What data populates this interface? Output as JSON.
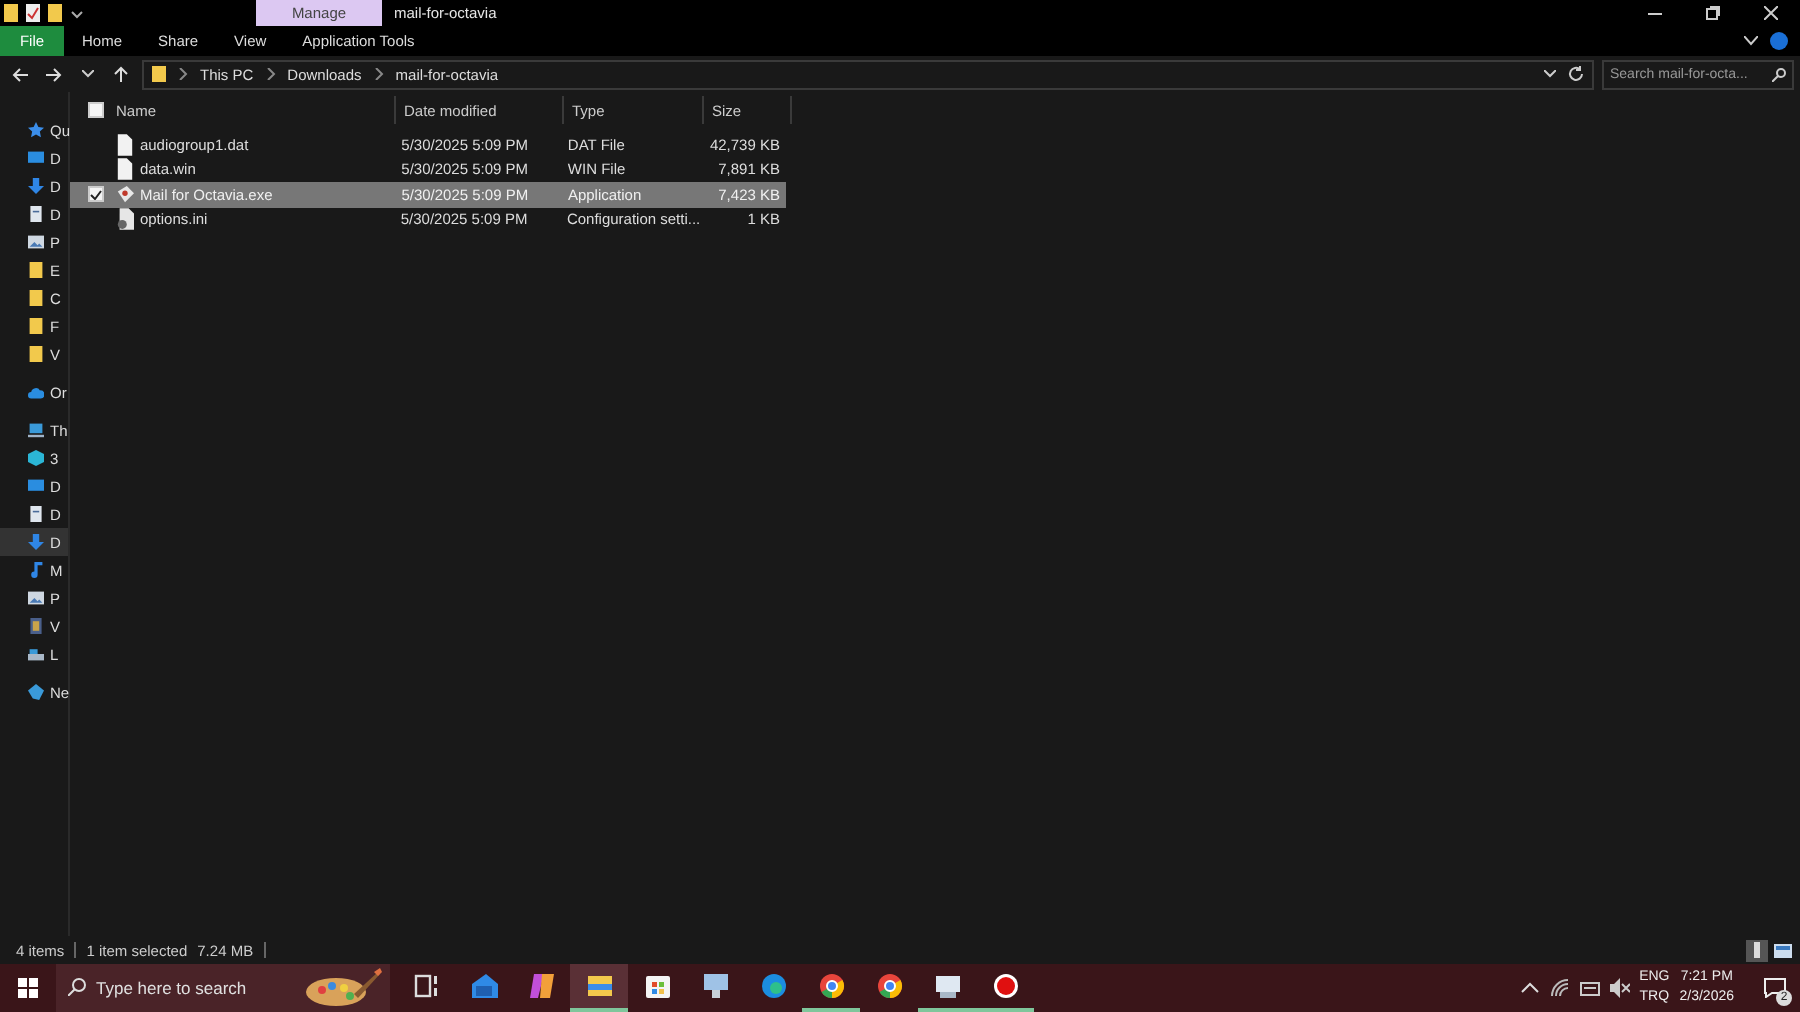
{
  "title_bar": {
    "context_tab": "Manage",
    "title": "mail-for-octavia"
  },
  "ribbon": {
    "tabs": [
      {
        "label": "File",
        "kind": "file"
      },
      {
        "label": "Home",
        "kind": "tab"
      },
      {
        "label": "Share",
        "kind": "tab"
      },
      {
        "label": "View",
        "kind": "tab"
      },
      {
        "label": "Application Tools",
        "kind": "tab"
      }
    ]
  },
  "address": {
    "breadcrumbs": [
      "This PC",
      "Downloads",
      "mail-for-octavia"
    ],
    "search": {
      "placeholder": "Search mail-for-octa..."
    }
  },
  "sidebar": {
    "items": [
      {
        "label": "Qu",
        "kind": "star",
        "selected": false
      },
      {
        "label": "D",
        "kind": "desktop",
        "selected": false
      },
      {
        "label": "D",
        "kind": "download",
        "selected": false
      },
      {
        "label": "D",
        "kind": "document",
        "selected": false
      },
      {
        "label": "P",
        "kind": "pictures",
        "selected": false
      },
      {
        "label": "E",
        "kind": "folder",
        "selected": false
      },
      {
        "label": "C",
        "kind": "folder",
        "selected": false
      },
      {
        "label": "F",
        "kind": "folder",
        "selected": false
      },
      {
        "label": "V",
        "kind": "folder",
        "selected": false
      },
      {
        "label": "Or",
        "kind": "cloud",
        "selected": false
      },
      {
        "label": "Th",
        "kind": "pc",
        "selected": false
      },
      {
        "label": "3",
        "kind": "cube",
        "selected": false
      },
      {
        "label": "D",
        "kind": "desktop",
        "selected": false
      },
      {
        "label": "D",
        "kind": "document",
        "selected": false
      },
      {
        "label": "D",
        "kind": "download",
        "selected": true
      },
      {
        "label": "M",
        "kind": "music",
        "selected": false
      },
      {
        "label": "P",
        "kind": "pictures",
        "selected": false
      },
      {
        "label": "V",
        "kind": "video",
        "selected": false
      },
      {
        "label": "L",
        "kind": "drive",
        "selected": false
      },
      {
        "label": "Ne",
        "kind": "network",
        "selected": false
      }
    ]
  },
  "table": {
    "select_all": {
      "checked": false
    },
    "columns": [
      "Name",
      "Date modified",
      "Type",
      "Size"
    ],
    "rows": [
      {
        "name": "audiogroup1.dat",
        "date_modified": "5/30/2025 5:09 PM",
        "type": "DAT File",
        "size": "42,739 KB",
        "kind": "file",
        "selected": false
      },
      {
        "name": "data.win",
        "date_modified": "5/30/2025 5:09 PM",
        "type": "WIN File",
        "size": "7,891 KB",
        "kind": "file",
        "selected": false
      },
      {
        "name": "Mail for Octavia.exe",
        "date_modified": "5/30/2025 5:09 PM",
        "type": "Application",
        "size": "7,423 KB",
        "kind": "app",
        "selected": true
      },
      {
        "name": "options.ini",
        "date_modified": "5/30/2025 5:09 PM",
        "type": "Configuration setti...",
        "size": "1 KB",
        "kind": "settings",
        "selected": false
      }
    ]
  },
  "status_bar": {
    "item_count": "4 items",
    "selection": "1 item selected",
    "selection_size": "7.24 MB"
  },
  "taskbar": {
    "search": {
      "placeholder": "Type here to search"
    },
    "apps": [
      {
        "kind": "taskview",
        "running": false,
        "selected": false
      },
      {
        "kind": "mail",
        "running": false,
        "selected": false
      },
      {
        "kind": "copilot",
        "running": false,
        "selected": false
      },
      {
        "kind": "explorer",
        "running": true,
        "selected": true
      },
      {
        "kind": "store",
        "running": false,
        "selected": false
      },
      {
        "kind": "monitor",
        "running": false,
        "selected": false
      },
      {
        "kind": "edge",
        "running": false,
        "selected": false
      },
      {
        "kind": "chrome",
        "running": true,
        "selected": false
      },
      {
        "kind": "chrome",
        "running": false,
        "selected": false
      },
      {
        "kind": "computer",
        "running": true,
        "selected": false
      },
      {
        "kind": "record",
        "running": true,
        "selected": false
      }
    ],
    "tray": {
      "lang_top": "ENG",
      "lang_bottom": "TRQ",
      "time": "7:21 PM",
      "date": "2/3/2026",
      "notifications": "2"
    }
  }
}
